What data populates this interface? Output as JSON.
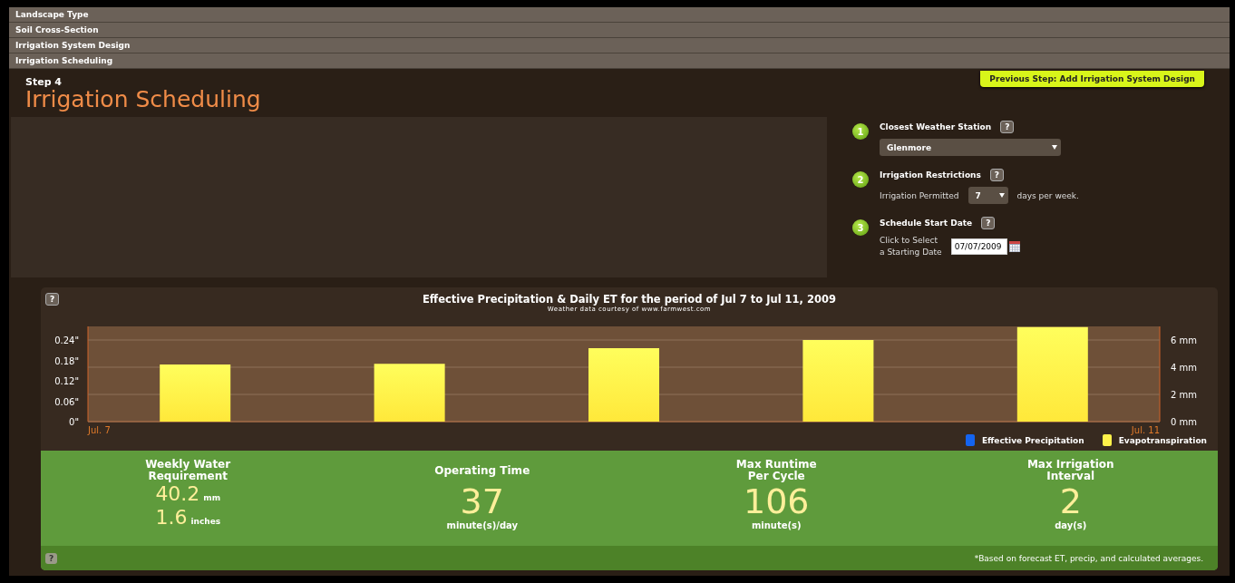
{
  "sections": [
    {
      "label": "Landscape Type"
    },
    {
      "label": "Soil Cross-Section"
    },
    {
      "label": "Irrigation System Design"
    },
    {
      "label": "Irrigation Scheduling"
    }
  ],
  "step": {
    "label": "Step 4",
    "title": "Irrigation Scheduling",
    "previous_button": "Previous Step: Add Irrigation System Design"
  },
  "form": {
    "steps": [
      {
        "number": "1",
        "title": "Closest Weather Station",
        "help": "?",
        "kind": "select",
        "value": "Glenmore"
      },
      {
        "number": "2",
        "title": "Irrigation Restrictions",
        "help": "?",
        "kind": "days",
        "label": "Irrigation Permitted",
        "value": "7",
        "suffix": "days per week."
      },
      {
        "number": "3",
        "title": "Schedule Start Date",
        "help": "?",
        "kind": "date",
        "label": [
          "Click to Select",
          "a Starting Date"
        ],
        "value": "07/07/2009"
      }
    ]
  },
  "chart": {
    "help": "?",
    "subtitle": "Weather data courtesy of www.farmwest.com",
    "chart_data": {
      "type": "bar",
      "title": "Effective Precipitation & Daily ET for the period of Jul 7 to Jul 11, 2009",
      "categories": [
        "Jul. 7",
        null,
        null,
        null,
        "Jul. 11"
      ],
      "grid": true,
      "ylim": [
        0,
        7
      ],
      "yticks": [
        {
          "value": 0,
          "label": "0 mm"
        },
        {
          "value": 2,
          "label": "2 mm"
        },
        {
          "value": 4,
          "label": "4 mm"
        },
        {
          "value": 6,
          "label": "6 mm"
        }
      ],
      "y2ticks": [
        {
          "value": 0,
          "label": "0\""
        },
        {
          "value": 0.06,
          "label": "0.06\""
        },
        {
          "value": 0.12,
          "label": "0.12\""
        },
        {
          "value": 0.18,
          "label": "0.18\""
        },
        {
          "value": 0.24,
          "label": "0.24\""
        }
      ],
      "y2lim": [
        0,
        0.28
      ],
      "series": [
        {
          "name": "Effective Precipitation",
          "color": "#1464f0",
          "values": [
            0,
            0,
            0,
            0,
            0
          ]
        },
        {
          "name": "Evapotranspiration",
          "color": "#fff24a",
          "values": [
            4.2,
            4.25,
            5.4,
            6.0,
            6.95
          ]
        }
      ]
    }
  },
  "results": {
    "metrics": [
      {
        "title": [
          "Weekly Water",
          "Requirement"
        ],
        "kind": "dual",
        "values": [
          {
            "value": "40.2",
            "unit": "mm"
          },
          {
            "value": "1.6",
            "unit": "inches"
          }
        ]
      },
      {
        "title": [
          "Operating Time"
        ],
        "kind": "single",
        "value": "37",
        "unit": "minute(s)/day"
      },
      {
        "title": [
          "Max Runtime",
          "Per Cycle"
        ],
        "kind": "single",
        "value": "106",
        "unit": "minute(s)"
      },
      {
        "title": [
          "Max Irrigation",
          "Interval"
        ],
        "kind": "single",
        "value": "2",
        "unit": "day(s)"
      }
    ],
    "help": "?",
    "footnote": "*Based on forecast ET, precip, and calculated averages."
  }
}
